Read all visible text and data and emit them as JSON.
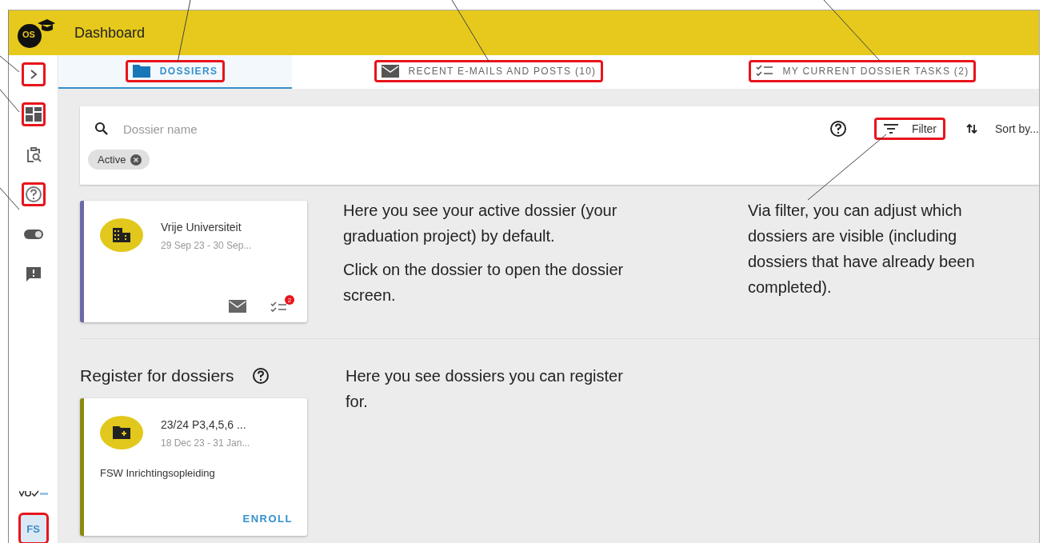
{
  "header": {
    "logo_text": "OS",
    "title": "Dashboard"
  },
  "sidebar": {
    "items": [
      {
        "kind": "chevron",
        "highlighted": true
      },
      {
        "kind": "dashboard",
        "highlighted": true
      },
      {
        "kind": "clipboard-search",
        "highlighted": false
      },
      {
        "kind": "help",
        "highlighted": true
      },
      {
        "kind": "toggle",
        "highlighted": false
      },
      {
        "kind": "feedback",
        "highlighted": false
      }
    ],
    "avatar": {
      "initials": "FS",
      "highlighted": true
    }
  },
  "tabs": [
    {
      "label": "DOSSIERS",
      "kind": "folder",
      "selected": true,
      "highlighted": true
    },
    {
      "label": "RECENT E-MAILS AND POSTS (10)",
      "kind": "mail",
      "selected": false,
      "highlighted": true
    },
    {
      "label": "MY CURRENT DOSSIER TASKS (2)",
      "kind": "checklist",
      "selected": false,
      "highlighted": true
    }
  ],
  "search": {
    "placeholder": "Dossier name"
  },
  "toolbar": {
    "filter_label": "Filter",
    "filter_highlighted": true,
    "sort_label": "Sort by..."
  },
  "chips": [
    {
      "label": "Active"
    }
  ],
  "dossiers": [
    {
      "title": "Vrije Universiteit",
      "dates": "29 Sep 23 - 30 Sep...",
      "color": "#6a6aa8",
      "task_count": "2"
    }
  ],
  "register": {
    "title": "Register for dossiers",
    "cards": [
      {
        "title": "23/24 P3,4,5,6 ...",
        "dates": "18 Dec 23 - 31 Jan...",
        "description": "FSW Inrichtingsopleiding",
        "action": "ENROLL",
        "color": "#8a8a12"
      }
    ]
  },
  "callouts": {
    "active": [
      "Here you see your active dossier (your graduation project) by default.",
      "Click on the dossier to open the dossier screen."
    ],
    "filter": [
      "Via filter, you can adjust which dossiers are visible (including dossiers that have already been completed)."
    ],
    "register": [
      "Here you see dossiers you can register for."
    ]
  }
}
